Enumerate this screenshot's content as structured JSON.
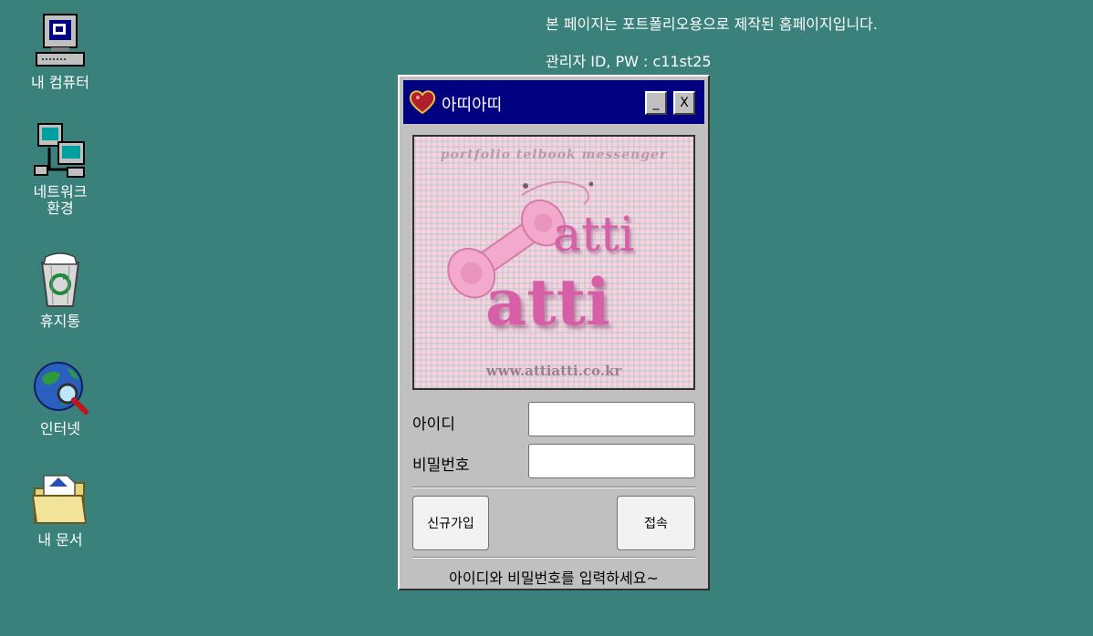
{
  "notice": {
    "line1": "본 페이지는 포트폴리오용으로 제작된 홈페이지입니다.",
    "line2": "관리자 ID, PW : c11st25"
  },
  "desktop_icons": [
    {
      "label": "내 컴퓨터",
      "icon": "computer-icon"
    },
    {
      "label": "네트워크\n환경",
      "icon": "network-icon"
    },
    {
      "label": "휴지통",
      "icon": "recycle-bin-icon"
    },
    {
      "label": "인터넷",
      "icon": "internet-icon"
    },
    {
      "label": "내 문서",
      "icon": "folder-icon"
    }
  ],
  "window": {
    "title": "아띠아띠",
    "minimize_label": "_",
    "close_label": "X",
    "logo": {
      "tagline": "portfolio telbook messenger",
      "word_top": "atti",
      "word_bottom": "atti",
      "url": "www.attiatti.co.kr"
    },
    "form": {
      "id_label": "아이디",
      "id_value": "",
      "pw_label": "비밀번호",
      "pw_value": ""
    },
    "buttons": {
      "signup": "신규가입",
      "login": "접속"
    },
    "status": "아이디와 비밀번호를 입력하세요~"
  },
  "colors": {
    "desktop": "#3a807b",
    "titlebar": "#000080",
    "window": "#c0c0c0",
    "logo_pink": "#d65fa7"
  }
}
